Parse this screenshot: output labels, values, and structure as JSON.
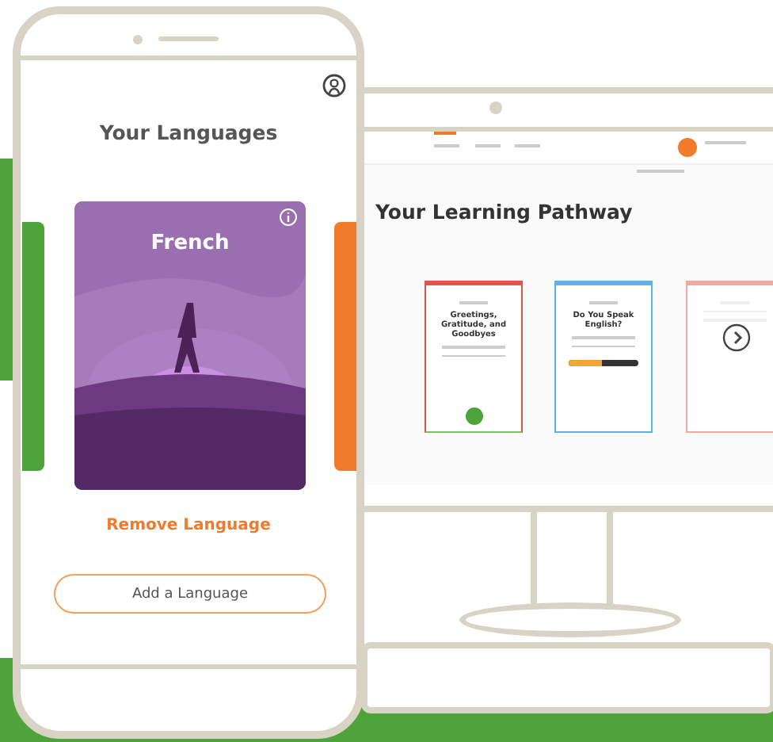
{
  "phone": {
    "title": "Your Languages",
    "card": {
      "language": "French"
    },
    "remove_link": "Remove Language",
    "add_button": "Add a Language"
  },
  "desktop": {
    "title": "Your Learning Pathway",
    "cards": [
      {
        "title": "Greetings, Gratitude, and Goodbyes",
        "kind": "done",
        "color": "#e0544a"
      },
      {
        "title": "Do You Speak English?",
        "kind": "progress",
        "color": "#5fb3ea",
        "level": 0.48
      },
      {
        "kind": "faded",
        "color": "#f0a8a0"
      }
    ]
  }
}
